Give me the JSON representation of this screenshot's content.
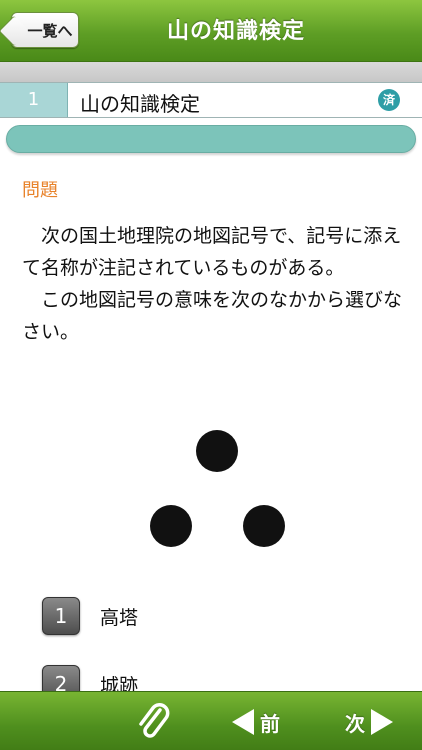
{
  "header": {
    "back_label": "一覧へ",
    "title": "山の知識検定"
  },
  "question": {
    "number": "1",
    "title": "山の知識検定",
    "status_badge": "済"
  },
  "problem": {
    "label": "問題",
    "paragraphs": [
      "次の国土地理院の地図記号で、記号に添えて名称が注記されているものがある。",
      "この地図記号の意味を次のなかから選びなさい。"
    ]
  },
  "choices": [
    {
      "number": "1",
      "label": "高塔"
    },
    {
      "number": "2",
      "label": "城跡"
    }
  ],
  "footer": {
    "prev_label": "前",
    "next_label": "次",
    "attachment_icon": "paperclip-icon"
  },
  "colors": {
    "header_green": "#5e9e25",
    "accent_orange": "#e8822a",
    "teal": "#7cc4ba",
    "badge_teal": "#2e9ea6"
  }
}
